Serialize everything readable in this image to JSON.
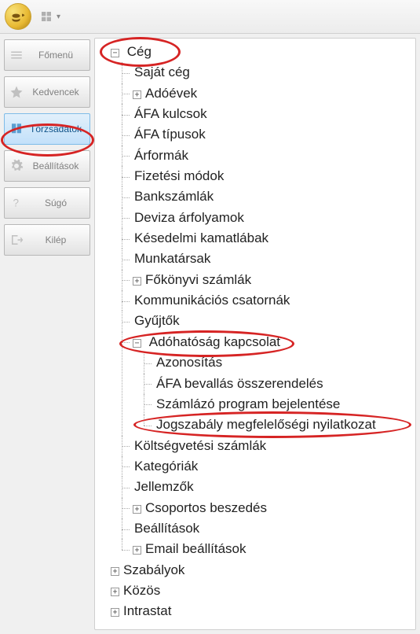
{
  "sidebar": {
    "items": [
      {
        "id": "home",
        "label": "Főmenü",
        "icon": "menu"
      },
      {
        "id": "fav",
        "label": "Kedvencek",
        "icon": "star"
      },
      {
        "id": "master",
        "label": "Törzsadatok",
        "icon": "book"
      },
      {
        "id": "settings",
        "label": "Beállítások",
        "icon": "gear"
      },
      {
        "id": "help",
        "label": "Súgó",
        "icon": "help"
      },
      {
        "id": "exit",
        "label": "Kilép",
        "icon": "exit"
      }
    ],
    "active": "master"
  },
  "tree": {
    "root": {
      "label": "Cég",
      "children": [
        {
          "label": "Saját cég"
        },
        {
          "label": "Adóévek",
          "expandable": true
        },
        {
          "label": "ÁFA kulcsok"
        },
        {
          "label": "ÁFA típusok"
        },
        {
          "label": "Árformák"
        },
        {
          "label": "Fizetési módok"
        },
        {
          "label": "Bankszámlák"
        },
        {
          "label": "Deviza árfolyamok"
        },
        {
          "label": "Késedelmi kamatlábak"
        },
        {
          "label": "Munkatársak"
        },
        {
          "label": "Főkönyvi számlák",
          "expandable": true
        },
        {
          "label": "Kommunikációs csatornák"
        },
        {
          "label": "Gyűjtők"
        },
        {
          "label": "Adóhatóság kapcsolat",
          "expanded": true,
          "children": [
            {
              "label": "Azonosítás"
            },
            {
              "label": "ÁFA bevallás összerendelés"
            },
            {
              "label": "Számlázó program bejelentése"
            },
            {
              "label": "Jogszabály megfelelőségi nyilatkozat"
            }
          ]
        },
        {
          "label": "Költségvetési számlák"
        },
        {
          "label": "Kategóriák"
        },
        {
          "label": "Jellemzők"
        },
        {
          "label": "Csoportos beszedés",
          "expandable": true
        },
        {
          "label": "Beállítások"
        },
        {
          "label": "Email beállítások",
          "expandable": true
        }
      ],
      "siblings": [
        {
          "label": "Szabályok",
          "expandable": true
        },
        {
          "label": "Közös",
          "expandable": true
        },
        {
          "label": "Intrastat",
          "expandable": true
        }
      ]
    }
  },
  "annotations": [
    {
      "target": "tree-root-ceg"
    },
    {
      "target": "sidebar-master"
    },
    {
      "target": "tree-adohatosag"
    },
    {
      "target": "tree-jogszabaly"
    }
  ]
}
